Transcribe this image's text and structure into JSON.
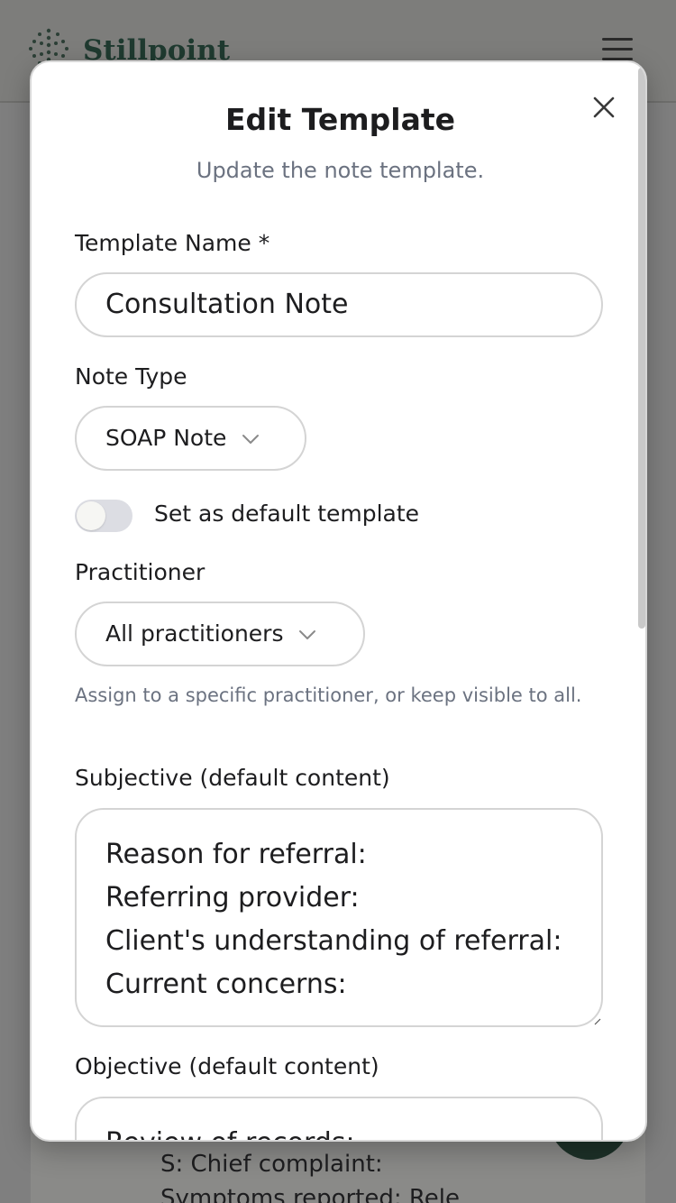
{
  "app": {
    "brand": "Stillpoint",
    "background_lines": [
      "S: Chief complaint:",
      "Symptoms reported: Rele"
    ]
  },
  "modal": {
    "title": "Edit Template",
    "subtitle": "Update the note template.",
    "close_icon": "close-icon",
    "fields": {
      "template_name": {
        "label": "Template Name *",
        "value": "Consultation Note"
      },
      "note_type": {
        "label": "Note Type",
        "selected": "SOAP Note"
      },
      "default_toggle": {
        "label": "Set as default template",
        "checked": false
      },
      "practitioner": {
        "label": "Practitioner",
        "selected": "All practitioners",
        "helper": "Assign to a specific practitioner, or keep visible to all."
      },
      "subjective": {
        "label": "Subjective (default content)",
        "lines": [
          "Reason for referral:",
          "Referring provider:",
          "Client's understanding of referral:",
          "Current concerns:"
        ]
      },
      "objective": {
        "label": "Objective (default content)",
        "lines": [
          "Review of records:"
        ]
      }
    }
  },
  "colors": {
    "brand": "#1f3a30",
    "muted_text": "#6b7280",
    "border": "#d4d4d4",
    "toggle_off": "#dcdde3"
  }
}
